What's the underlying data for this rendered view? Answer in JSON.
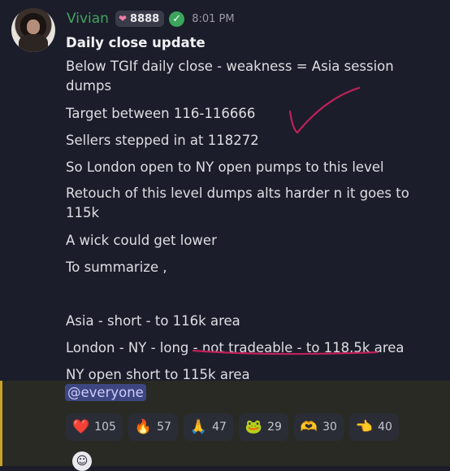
{
  "message": {
    "username": "Vivian",
    "badge_value": "8888",
    "time": "8:01 PM",
    "title": "Daily close update",
    "lines": [
      "Below TGIf daily close - weakness = Asia session dumps",
      "Target between 116-116666",
      "Sellers stepped in at 118272",
      "So London open to NY open pumps to this level",
      "Retouch of this level dumps alts harder n it goes to 115k",
      "A wick could get lower",
      "To summarize ,",
      "",
      "Asia - short - to 116k area",
      "London - NY - long - not tradeable - to 118.5k area",
      "NY open short to 115k area"
    ],
    "mention": "@everyone"
  },
  "reactions": [
    {
      "icon": "red-heart-icon",
      "glyph": "❤️",
      "count": "105"
    },
    {
      "icon": "fire-icon",
      "glyph": "🔥",
      "count": "57"
    },
    {
      "icon": "folded-hands-icon",
      "glyph": "🙏",
      "count": "47"
    },
    {
      "icon": "pepe-money-icon",
      "glyph": "🐸",
      "count": "29"
    },
    {
      "icon": "heart-hands-icon",
      "glyph": "🫶",
      "count": "30"
    },
    {
      "icon": "pointing-hand-icon",
      "glyph": "👈",
      "count": "40"
    }
  ],
  "colors": {
    "username": "#3fa45e",
    "mention_bg": "#3e4681",
    "mention_highlight_bar": "#c9a227",
    "annotation": "#c0215a"
  }
}
